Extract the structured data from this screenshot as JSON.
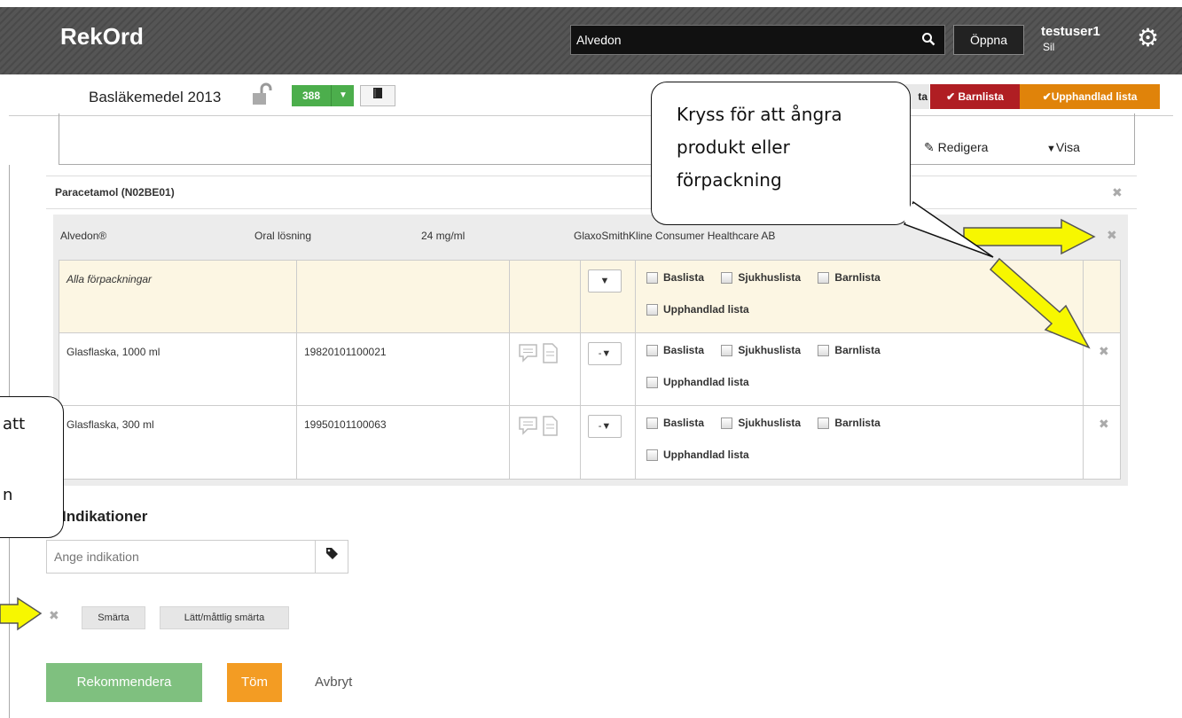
{
  "header": {
    "app_title": "RekOrd",
    "search_value": "Alvedon",
    "open_label": "Öppna",
    "user_name": "testuser1",
    "user_sub": "Sil"
  },
  "subbar": {
    "list_title": "Basläkemedel 2013",
    "count": "388",
    "badge_partial": "ta",
    "badge_barnlista": "Barnlista",
    "badge_upphandlad": "Upphandlad lista",
    "edit_label": "Redigera",
    "show_label": "Visa"
  },
  "substance": {
    "name": "Paracetamol (N02BE01)"
  },
  "product": {
    "name": "Alvedon®",
    "form": "Oral lösning",
    "strength": "24 mg/ml",
    "manufacturer": "GlaxoSmithKline Consumer Healthcare AB"
  },
  "packages": {
    "checkbox_labels": [
      "Baslista",
      "Sjukhuslista",
      "Barnlista",
      "Upphandlad lista"
    ],
    "rows": [
      {
        "name": "Alla förpackningar",
        "code": "",
        "dropdown": ""
      },
      {
        "name": "Glasflaska, 1000 ml",
        "code": "19820101100021",
        "dropdown": "-"
      },
      {
        "name": "Glasflaska, 300 ml",
        "code": "19950101100063",
        "dropdown": "-"
      }
    ]
  },
  "indications": {
    "title": "Indikationer",
    "input_placeholder": "Ange indikation",
    "tags": [
      "Smärta",
      "Lätt/måttlig smärta"
    ]
  },
  "actions": {
    "recommend": "Rekommendera",
    "clear": "Töm",
    "cancel": "Avbryt"
  },
  "callouts": {
    "right_lines": [
      "Kryss för att ångra",
      "produkt eller",
      "förpackning"
    ],
    "left_lines": [
      "att",
      "",
      "n"
    ]
  },
  "colors": {
    "accent_green": "#4cae4c",
    "barnlista_red": "#b01e23",
    "upphandlad_orange": "#e0830a",
    "arrow_yellow": "#f7f700"
  }
}
